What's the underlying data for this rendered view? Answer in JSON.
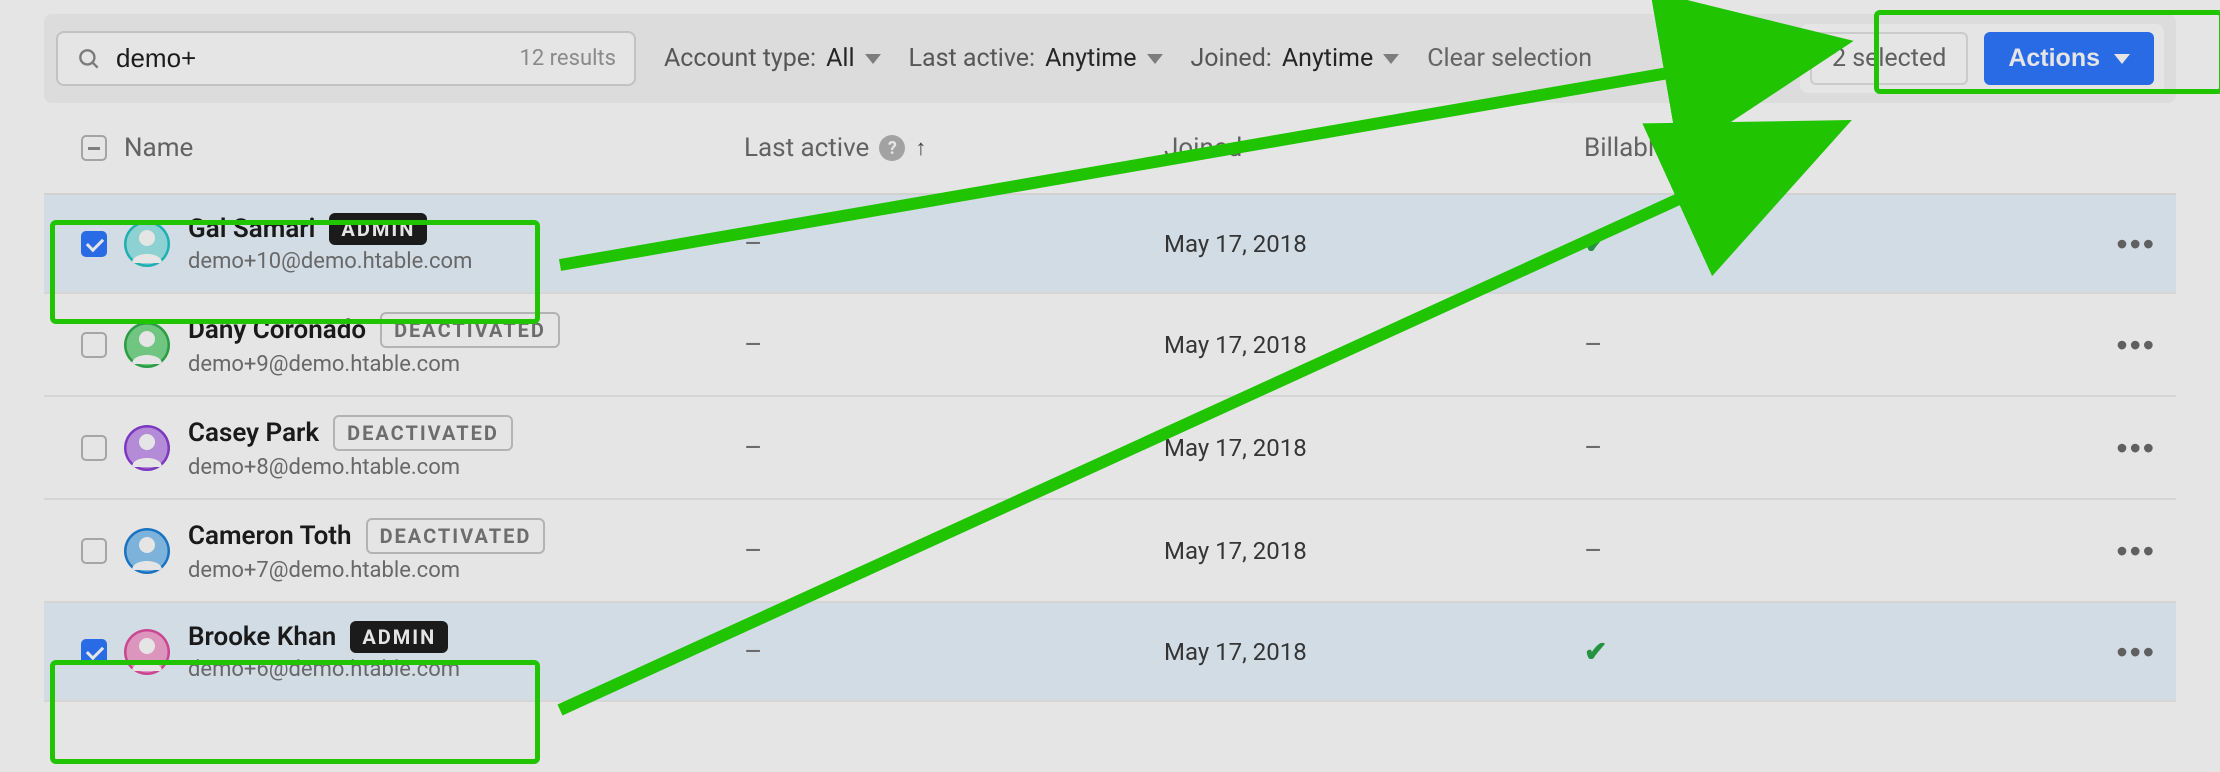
{
  "search": {
    "value": "demo+",
    "results_text": "12 results"
  },
  "filters": {
    "account_type": {
      "label": "Account type:",
      "value": "All"
    },
    "last_active": {
      "label": "Last active:",
      "value": "Anytime"
    },
    "joined": {
      "label": "Joined:",
      "value": "Anytime"
    }
  },
  "clear_selection_label": "Clear selection",
  "selection": {
    "count_text": "2 selected"
  },
  "actions_button_label": "Actions",
  "columns": {
    "name": "Name",
    "last_active": "Last active",
    "joined": "Joined",
    "billable": "Billable?"
  },
  "badge_labels": {
    "admin": "ADMIN",
    "deactivated": "DEACTIVATED"
  },
  "avatar_colors": {
    "teal": {
      "ring": "#22c3c7",
      "fill": "#9ee9ea"
    },
    "green": {
      "ring": "#2fae4b",
      "fill": "#7ddc90"
    },
    "purple": {
      "ring": "#8b3fd6",
      "fill": "#c99bf0"
    },
    "blue": {
      "ring": "#1e7fd6",
      "fill": "#8cc8f4"
    },
    "pink": {
      "ring": "#e14fa1",
      "fill": "#f5a6d2"
    }
  },
  "rows": [
    {
      "selected": true,
      "avatar": "teal",
      "name": "Gal Samari",
      "badge": "admin",
      "email": "demo+10@demo.htable.com",
      "last_active": "–",
      "joined": "May 17, 2018",
      "billable": true
    },
    {
      "selected": false,
      "avatar": "green",
      "name": "Dany Coronado",
      "badge": "deactivated",
      "email": "demo+9@demo.htable.com",
      "last_active": "–",
      "joined": "May 17, 2018",
      "billable": false
    },
    {
      "selected": false,
      "avatar": "purple",
      "name": "Casey Park",
      "badge": "deactivated",
      "email": "demo+8@demo.htable.com",
      "last_active": "–",
      "joined": "May 17, 2018",
      "billable": false
    },
    {
      "selected": false,
      "avatar": "blue",
      "name": "Cameron Toth",
      "badge": "deactivated",
      "email": "demo+7@demo.htable.com",
      "last_active": "–",
      "joined": "May 17, 2018",
      "billable": false
    },
    {
      "selected": true,
      "avatar": "pink",
      "name": "Brooke Khan",
      "badge": "admin",
      "email": "demo+6@demo.htable.com",
      "last_active": "–",
      "joined": "May 17, 2018",
      "billable": true
    }
  ]
}
